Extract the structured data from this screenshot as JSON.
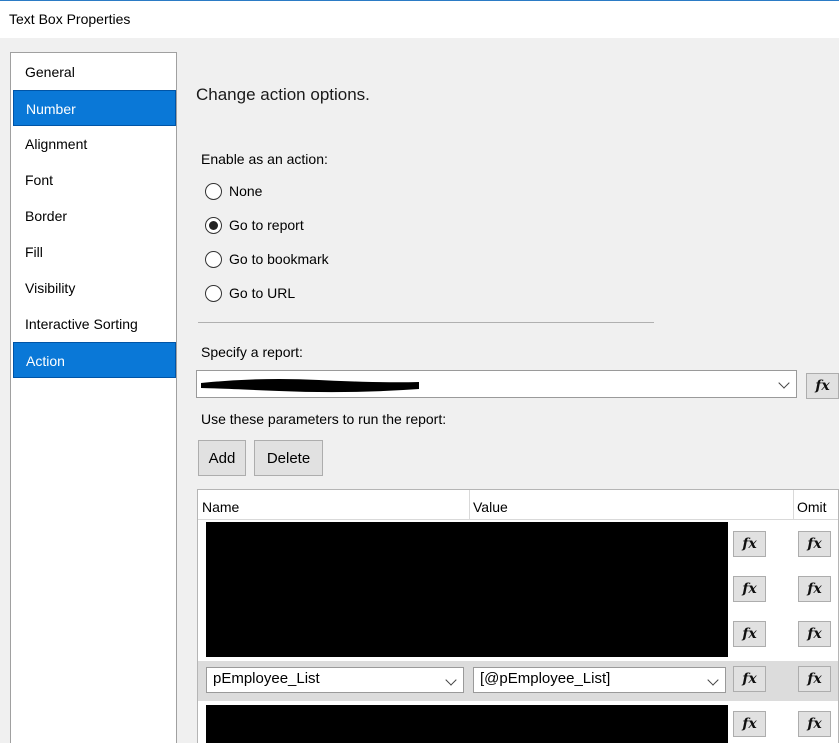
{
  "window": {
    "title": "Text Box Properties"
  },
  "sidebar": {
    "items": [
      {
        "label": "General",
        "selected": false
      },
      {
        "label": "Number",
        "selected": true
      },
      {
        "label": "Alignment",
        "selected": false
      },
      {
        "label": "Font",
        "selected": false
      },
      {
        "label": "Border",
        "selected": false
      },
      {
        "label": "Fill",
        "selected": false
      },
      {
        "label": "Visibility",
        "selected": false
      },
      {
        "label": "Interactive Sorting",
        "selected": false
      },
      {
        "label": "Action",
        "selected": true
      }
    ]
  },
  "main": {
    "heading": "Change action options.",
    "enable_label": "Enable as an action:",
    "options": [
      {
        "label": "None",
        "checked": false
      },
      {
        "label": "Go to report",
        "checked": true
      },
      {
        "label": "Go to bookmark",
        "checked": false
      },
      {
        "label": "Go to URL",
        "checked": false
      }
    ],
    "specify_label": "Specify a report:",
    "params_label": "Use these parameters to run the report:",
    "add_label": "Add",
    "delete_label": "Delete",
    "fx_label": "fx"
  },
  "grid": {
    "columns": [
      "Name",
      "Value",
      "Omit"
    ],
    "rows": [
      {
        "name": "",
        "value": "",
        "redacted": true
      },
      {
        "name": "",
        "value": "",
        "redacted": true
      },
      {
        "name": "",
        "value": "",
        "redacted": true
      },
      {
        "name": "pEmployee_List",
        "value": "[@pEmployee_List]",
        "redacted": false
      },
      {
        "name": "",
        "value": "",
        "redacted": true
      }
    ]
  },
  "colors": {
    "selection": "#0a78d7",
    "window_bg": "#f0f0f0",
    "redaction": "#000000"
  }
}
